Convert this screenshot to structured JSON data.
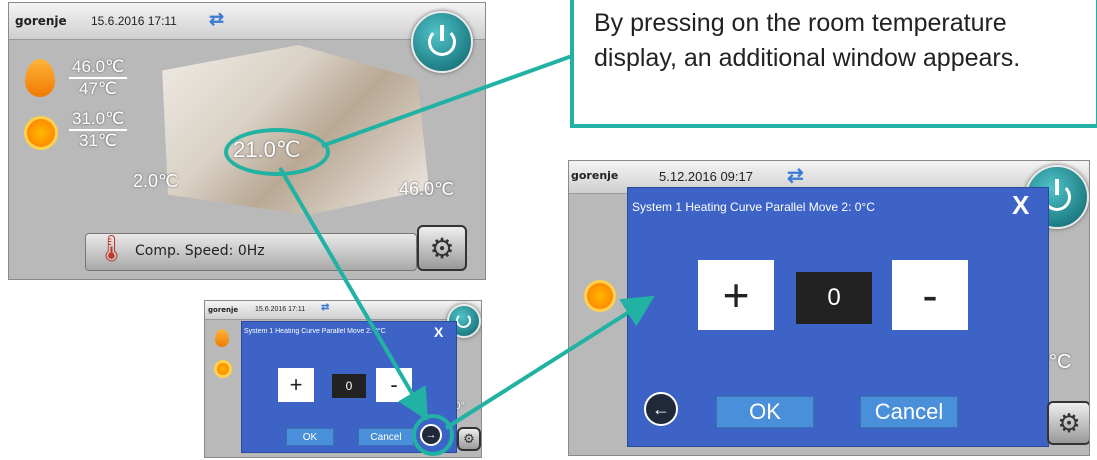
{
  "callout": {
    "text": "By pressing on the room temperature display, an additional window appears."
  },
  "screen1": {
    "logo": "gorenje",
    "datetime": "15.6.2016 17:11",
    "water_set": "46.0℃",
    "water_actual": "47℃",
    "solar_set": "31.0℃",
    "solar_actual": "31℃",
    "room_temp": "21.0℃",
    "outdoor_temp": "2.0℃",
    "boiler_temp": "46.0℃",
    "comp_speed": "Comp. Speed: 0Hz"
  },
  "screen2": {
    "logo": "gorenje",
    "datetime": "15.6.2016 17:11",
    "dialog_title": "System 1 Heating Curve Parallel Move 2: 0°C",
    "value": "0",
    "plus": "+",
    "minus": "-",
    "ok": "OK",
    "cancel": "Cancel",
    "close": "X",
    "temp_fragment": "0°"
  },
  "screen3": {
    "logo": "gorenje",
    "datetime": "5.12.2016 09:17",
    "dialog_title": "System 1 Heating Curve Parallel Move 2: 0°C",
    "value": "0",
    "plus": "+",
    "minus": "-",
    "ok": "OK",
    "cancel": "Cancel",
    "close": "X",
    "temp_fragment": "°C"
  },
  "colors": {
    "accent": "#22b2a4",
    "dialog": "#3d63c7",
    "button": "#4a8fd9"
  }
}
